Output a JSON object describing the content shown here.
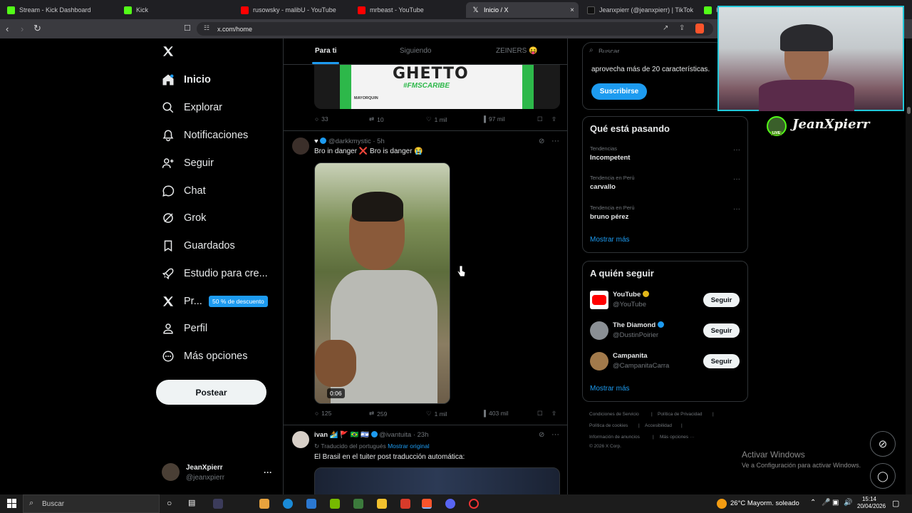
{
  "browser": {
    "tabs": [
      {
        "title": "Stream - Kick Dashboard",
        "favicon_color": "#53fc18"
      },
      {
        "title": "Kick",
        "favicon_color": "#53fc18"
      },
      {
        "title": "rusowsky - malibU - YouTube",
        "favicon_color": "#ff0000"
      },
      {
        "title": "mrbeast - YouTube",
        "favicon_color": "#ff0000"
      },
      {
        "title": "Inicio / X",
        "favicon_color": "#ffffff",
        "active": true
      },
      {
        "title": "Jeanxpierr (@jeanxpierr) | TikTok",
        "favicon_color": "#ffffff"
      },
      {
        "title": "K",
        "favicon_color": "#53fc18"
      }
    ],
    "close_glyph": "×",
    "url": "x.com/home"
  },
  "sidebar": {
    "items": [
      {
        "label": "Inicio",
        "icon": "home-icon"
      },
      {
        "label": "Explorar",
        "icon": "search-icon"
      },
      {
        "label": "Notificaciones",
        "icon": "bell-icon"
      },
      {
        "label": "Seguir",
        "icon": "person-plus-icon"
      },
      {
        "label": "Chat",
        "icon": "chat-icon"
      },
      {
        "label": "Grok",
        "icon": "grok-icon"
      },
      {
        "label": "Guardados",
        "icon": "bookmark-icon"
      },
      {
        "label": "Estudio para cre...",
        "icon": "rocket-icon"
      },
      {
        "label": "Pr...",
        "icon": "x-logo-icon"
      },
      {
        "label": "Perfil",
        "icon": "person-icon"
      },
      {
        "label": "Más opciones",
        "icon": "more-circle-icon"
      }
    ],
    "promo_badge": "50 % de descuento",
    "post_button": "Postear",
    "account": {
      "name": "JeanXpierr",
      "handle": "@jeanxpierr",
      "more": "···"
    }
  },
  "feed": {
    "tabs": [
      "Para ti",
      "Siguiendo",
      "ZEINERS 😝"
    ],
    "banner": {
      "title": "GHETTO",
      "subtitle": "#FMSCARIBE",
      "sponsor": "MAYORQUIN"
    },
    "post1_stats": {
      "replies": "33",
      "reposts": "10",
      "likes": "1 mil",
      "views": "97 mil"
    },
    "post2": {
      "prefix": "♥",
      "handle": "@darkkmystic",
      "time": "· 5h",
      "text": "Bro in danger ❌ Bro is danger 😭",
      "duration": "0:06",
      "stats": {
        "replies": "125",
        "reposts": "259",
        "likes": "1 mil",
        "views": "403 mil"
      },
      "more": "···"
    },
    "post3": {
      "name": "ivan 🏄 🚩 🇧🇷 🇮🇱",
      "handle": "@ivantuita",
      "time": "· 23h",
      "translated": "Traducido del portugués",
      "show_original": "Mostrar original",
      "text": "El Brasil en el tuiter post traducción automática:",
      "more": "···"
    }
  },
  "right": {
    "search_placeholder": "Buscar",
    "premium_text": "aprovecha más de 20 características.",
    "subscribe": "Suscribirse",
    "trends_title": "Qué está pasando",
    "trends": [
      {
        "label": "Tendencias",
        "name": "Incompetent"
      },
      {
        "label": "Tendencia en Perú",
        "name": "carvallo"
      },
      {
        "label": "Tendencia en Perú",
        "name": "bruno pérez"
      }
    ],
    "trends_more": "···",
    "show_more": "Mostrar más",
    "follow_title": "A quién seguir",
    "follow": [
      {
        "name": "YouTube",
        "handle": "@YouTube",
        "badge_color": "#e2b719"
      },
      {
        "name": "The Diamond",
        "handle": "@DustinPoirier",
        "badge_color": "#1d9bf0"
      },
      {
        "name": "Campanita",
        "handle": "@CampanitaCarra",
        "badge_color": ""
      }
    ],
    "follow_button": "Seguir",
    "follow_more": "Mostrar más",
    "footer": [
      "Condiciones de Servicio",
      "|",
      "Política de Privacidad",
      "|",
      "Política de cookies",
      "|",
      "Accesibilidad",
      "|",
      "Información de anuncios",
      "|",
      "Más opciones ···",
      "© 2026 X Corp."
    ]
  },
  "overlay": {
    "streamer_name": "JeanXpierr",
    "live_badge": "LIVE",
    "activate_windows_title": "Activar Windows",
    "activate_windows_sub": "Ve a Configuración para activar Windows."
  },
  "taskbar": {
    "search": "Buscar",
    "weather": "26°C",
    "weather_desc": "Mayorm. soleado",
    "time": "15:14",
    "date": "20/04/2026"
  }
}
